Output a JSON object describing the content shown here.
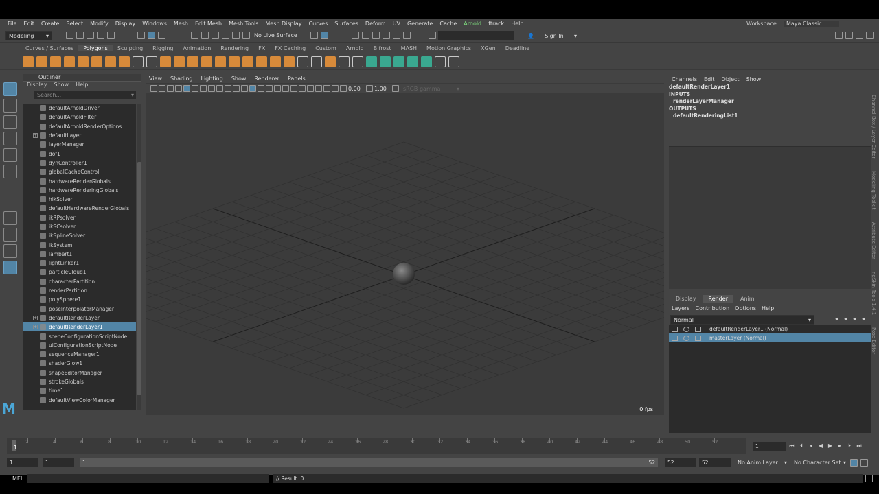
{
  "menubar": [
    "File",
    "Edit",
    "Create",
    "Select",
    "Modify",
    "Display",
    "Windows",
    "Mesh",
    "Edit Mesh",
    "Mesh Tools",
    "Mesh Display",
    "Curves",
    "Surfaces",
    "Deform",
    "UV",
    "Generate",
    "Cache",
    "Arnold",
    "ftrack",
    "Help"
  ],
  "workspace": {
    "label": "Workspace :",
    "value": "Maya Classic"
  },
  "status": {
    "mode": "Modeling",
    "live_surface": "No Live Surface",
    "sign_in": "Sign In"
  },
  "shelf_tabs": [
    "Curves / Surfaces",
    "Polygons",
    "Sculpting",
    "Rigging",
    "Animation",
    "Rendering",
    "FX",
    "FX Caching",
    "Custom",
    "Arnold",
    "Bifrost",
    "MASH",
    "Motion Graphics",
    "XGen",
    "Deadline"
  ],
  "shelf_active": "Polygons",
  "outliner": {
    "title": "Outliner",
    "menu": [
      "Display",
      "Show",
      "Help"
    ],
    "search_placeholder": "Search...",
    "items": [
      {
        "label": "defaultArnoldDriver",
        "exp": false
      },
      {
        "label": "defaultArnoldFilter",
        "exp": false
      },
      {
        "label": "defaultArnoldRenderOptions",
        "exp": false
      },
      {
        "label": "defaultLayer",
        "exp": true
      },
      {
        "label": "layerManager",
        "exp": false
      },
      {
        "label": "dof1",
        "exp": false
      },
      {
        "label": "dynController1",
        "exp": false
      },
      {
        "label": "globalCacheControl",
        "exp": false
      },
      {
        "label": "hardwareRenderGlobals",
        "exp": false
      },
      {
        "label": "hardwareRenderingGlobals",
        "exp": false
      },
      {
        "label": "hikSolver",
        "exp": false
      },
      {
        "label": "defaultHardwareRenderGlobals",
        "exp": false
      },
      {
        "label": "ikRPsolver",
        "exp": false
      },
      {
        "label": "ikSCsolver",
        "exp": false
      },
      {
        "label": "ikSplineSolver",
        "exp": false
      },
      {
        "label": "ikSystem",
        "exp": false
      },
      {
        "label": "lambert1",
        "exp": false
      },
      {
        "label": "lightLinker1",
        "exp": false
      },
      {
        "label": "particleCloud1",
        "exp": false
      },
      {
        "label": "characterPartition",
        "exp": false
      },
      {
        "label": "renderPartition",
        "exp": false
      },
      {
        "label": "polySphere1",
        "exp": false
      },
      {
        "label": "poseInterpolatorManager",
        "exp": false
      },
      {
        "label": "defaultRenderLayer",
        "exp": true
      },
      {
        "label": "defaultRenderLayer1",
        "exp": true,
        "selected": true
      },
      {
        "label": "sceneConfigurationScriptNode",
        "exp": false
      },
      {
        "label": "uiConfigurationScriptNode",
        "exp": false
      },
      {
        "label": "sequenceManager1",
        "exp": false
      },
      {
        "label": "shaderGlow1",
        "exp": false
      },
      {
        "label": "shapeEditorManager",
        "exp": false
      },
      {
        "label": "strokeGlobals",
        "exp": false
      },
      {
        "label": "time1",
        "exp": false
      },
      {
        "label": "defaultViewColorManager",
        "exp": false
      }
    ]
  },
  "viewport": {
    "menu": [
      "View",
      "Shading",
      "Lighting",
      "Show",
      "Renderer",
      "Panels"
    ],
    "near": "0.00",
    "far": "1.00",
    "gamma": "sRGB gamma",
    "fps": "0 fps"
  },
  "channelbox": {
    "menu": [
      "Channels",
      "Edit",
      "Object",
      "Show"
    ],
    "node": "defaultRenderLayer1",
    "inputs_label": "INPUTS",
    "input": "renderLayerManager",
    "outputs_label": "OUTPUTS",
    "output": "defaultRenderingList1"
  },
  "layer_editor": {
    "tabs": [
      "Display",
      "Render",
      "Anim"
    ],
    "active": "Render",
    "menu": [
      "Layers",
      "Contribution",
      "Options",
      "Help"
    ],
    "blend": "Normal",
    "layers": [
      {
        "label": "defaultRenderLayer1 (Normal)",
        "selected": false
      },
      {
        "label": "masterLayer (Normal)",
        "selected": true
      }
    ]
  },
  "side_tabs": [
    "Channel Box / Layer Editor",
    "Modeling Toolkit",
    "Attribute Editor",
    "ngSkin Tools 1.4.1",
    "Pose Editor"
  ],
  "timeline": {
    "ticks": [
      "2",
      "4",
      "6",
      "8",
      "10",
      "12",
      "14",
      "16",
      "18",
      "20",
      "22",
      "24",
      "26",
      "28",
      "30",
      "32",
      "34",
      "36",
      "38",
      "40",
      "42",
      "44",
      "46",
      "48",
      "50",
      "52"
    ],
    "current": "1",
    "frame_field": "1"
  },
  "range": {
    "start": "1",
    "start2": "1",
    "slider_start": "1",
    "slider_end": "52",
    "end": "52",
    "end2": "52",
    "anim_layer": "No Anim Layer",
    "char_set": "No Character Set"
  },
  "cmd": {
    "lang": "MEL",
    "result": "// Result: 0"
  }
}
